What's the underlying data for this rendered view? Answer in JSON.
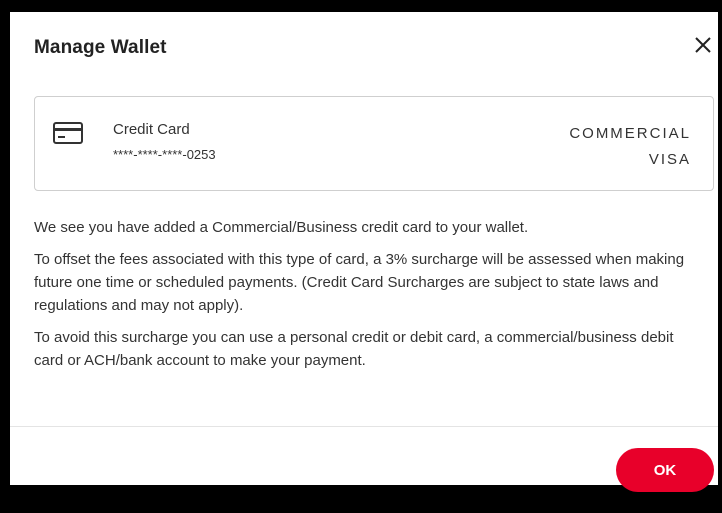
{
  "dialog": {
    "title": "Manage Wallet",
    "close_icon": "close-icon",
    "ok_label": "OK"
  },
  "card": {
    "icon": "credit-card-icon",
    "type": "Credit Card",
    "number": "****-****-****-0253",
    "brand_line1": "COMMERCIAL",
    "brand_line2": "VISA"
  },
  "messages": [
    "We see you have added a Commercial/Business credit card to your wallet.",
    "To offset the fees associated with this type of card, a 3% surcharge will be assessed when making future one time or scheduled payments. (Credit Card Surcharges are subject to state laws and regulations and may not apply).",
    "To avoid this surcharge you can use a personal credit or debit card, a commercial/business debit card or ACH/bank account to make your payment."
  ],
  "colors": {
    "accent": "#e8002a",
    "frame": "#000000"
  }
}
